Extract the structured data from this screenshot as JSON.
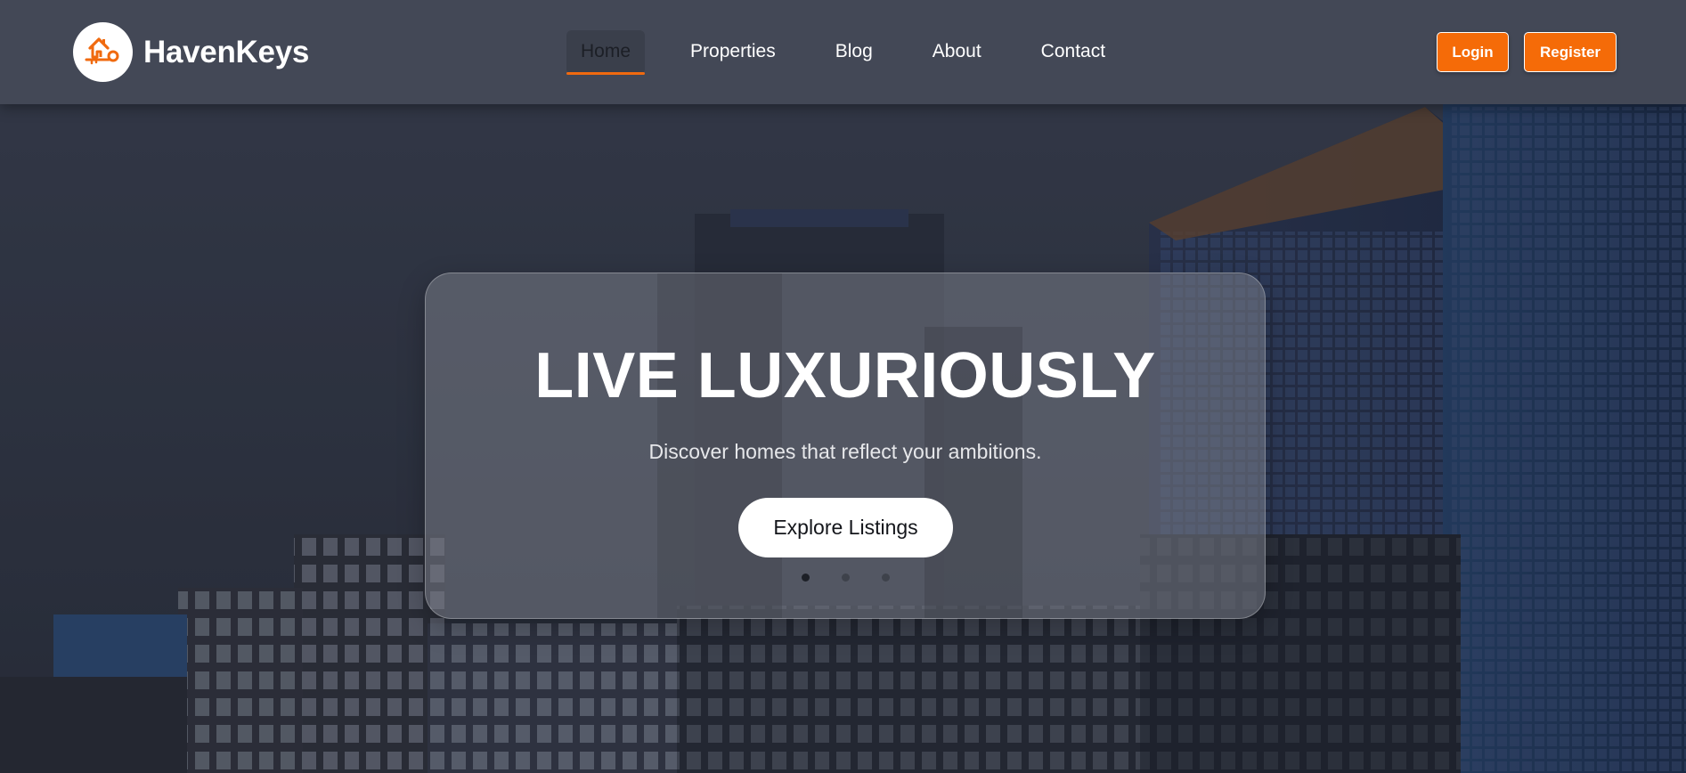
{
  "brand": {
    "name": "HavenKeys",
    "logo_icon": "house-key-icon",
    "accent_color": "#f56b08"
  },
  "nav": {
    "items": [
      {
        "label": "Home",
        "active": true
      },
      {
        "label": "Properties",
        "active": false
      },
      {
        "label": "Blog",
        "active": false
      },
      {
        "label": "About",
        "active": false
      },
      {
        "label": "Contact",
        "active": false
      }
    ]
  },
  "auth": {
    "login_label": "Login",
    "register_label": "Register"
  },
  "hero": {
    "title": "LIVE LUXURIOUSLY",
    "subtitle": "Discover homes that reflect your ambitions.",
    "cta_label": "Explore Listings",
    "slides_total": 3,
    "slide_active": 1,
    "background": "city-skyline-image"
  }
}
